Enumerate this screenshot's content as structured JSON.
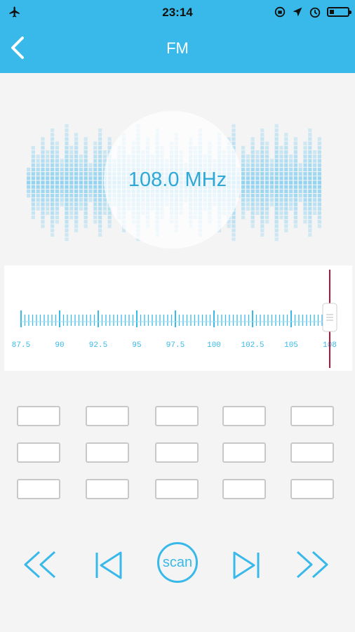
{
  "status_bar": {
    "time": "23:14"
  },
  "header": {
    "title": "FM"
  },
  "radio": {
    "frequency_display": "108.0 MHz",
    "frequency_value": 108.0
  },
  "tuner": {
    "min": 87.5,
    "max": 108,
    "current": 108.0,
    "tick_labels": [
      "87.5",
      "90",
      "92.5",
      "95",
      "97.5",
      "100",
      "102.5",
      "105",
      "108"
    ]
  },
  "presets": {
    "rows": 3,
    "columns": 5,
    "count": 15
  },
  "controls": {
    "scan_label": "scan",
    "icons": [
      "rewind-icon",
      "previous-icon",
      "scan-icon",
      "next-icon",
      "fast-forward-icon"
    ]
  },
  "colors": {
    "accent": "#39b9e9",
    "text_blue": "#2fa8d8",
    "needle": "#b5133a"
  }
}
